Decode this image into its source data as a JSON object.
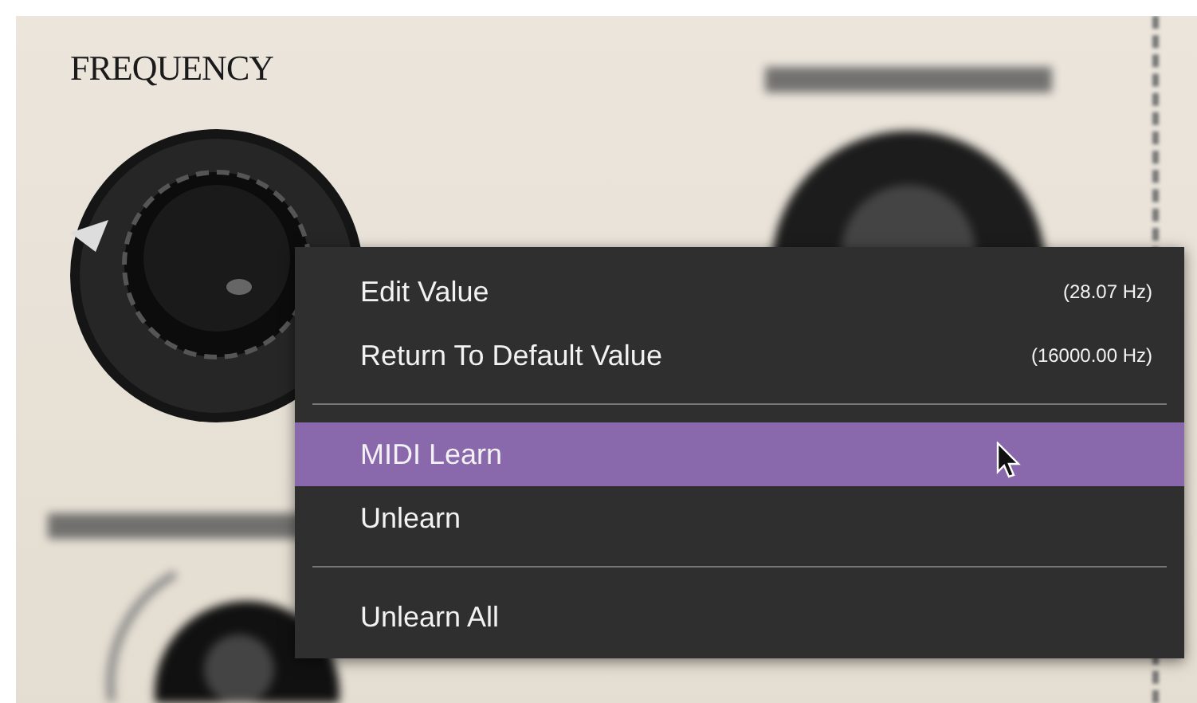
{
  "panel": {
    "label": "FREQUENCY"
  },
  "context_menu": {
    "items": [
      {
        "kind": "item",
        "label": "Edit Value",
        "value": "(28.07 Hz)",
        "selected": false
      },
      {
        "kind": "item",
        "label": "Return To Default Value",
        "value": "(16000.00 Hz)",
        "selected": false
      },
      {
        "kind": "separator"
      },
      {
        "kind": "item",
        "label": "MIDI Learn",
        "selected": true
      },
      {
        "kind": "item",
        "label": "Unlearn",
        "selected": false
      },
      {
        "kind": "separator"
      },
      {
        "kind": "item",
        "label": "Unlearn All",
        "selected": false
      }
    ]
  }
}
